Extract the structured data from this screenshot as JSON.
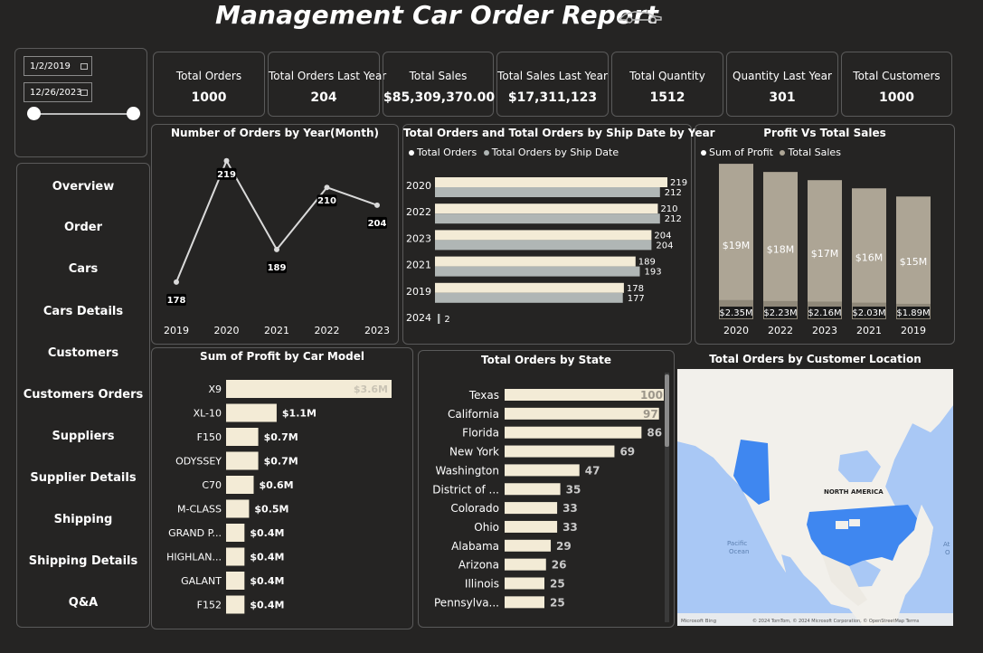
{
  "title": "Management Car Order Report",
  "date_filter": {
    "start": "1/2/2019",
    "end": "12/26/2023"
  },
  "kpis": [
    {
      "label": "Total Orders",
      "value": "1000"
    },
    {
      "label": "Total Orders Last Year",
      "value": "204"
    },
    {
      "label": "Total Sales",
      "value": "$85,309,370.00"
    },
    {
      "label": "Total Sales Last Year",
      "value": "$17,311,123"
    },
    {
      "label": "Total Quantity",
      "value": "1512"
    },
    {
      "label": "Quantity Last Year",
      "value": "301"
    },
    {
      "label": "Total Customers",
      "value": "1000"
    }
  ],
  "nav": [
    "Overview",
    "Order",
    "Cars",
    "Cars Details",
    "Customers",
    "Customers Orders",
    "Suppliers",
    "Supplier Details",
    "Shipping",
    "Shipping Details",
    "Q&A"
  ],
  "colors": {
    "bg": "#252423",
    "cream": "#F3EBD6",
    "gray": "#B0B6B5",
    "taupe": "#ADA595",
    "line": "#DADADA",
    "map_land": "#F2F0EB",
    "map_water": "#A9C8F5",
    "map_highlight": "#3F87F0"
  },
  "chart_data": [
    {
      "type": "line",
      "title": "Number of Orders by Year(Month)",
      "categories": [
        "2019",
        "2020",
        "2021",
        "2022",
        "2023"
      ],
      "values": [
        178,
        219,
        189,
        210,
        204
      ],
      "ylim": [
        170,
        222
      ]
    },
    {
      "type": "bar",
      "orientation": "horizontal",
      "title": "Total Orders and Total Orders by Ship Date by Year",
      "categories": [
        "2020",
        "2022",
        "2023",
        "2021",
        "2019",
        "2024"
      ],
      "series": [
        {
          "name": "Total Orders",
          "values": [
            219,
            210,
            204,
            189,
            178,
            null
          ]
        },
        {
          "name": "Total Orders by Ship Date",
          "values": [
            212,
            212,
            204,
            193,
            177,
            2
          ]
        }
      ],
      "xlim": [
        0,
        219
      ]
    },
    {
      "type": "bar",
      "title": "Profit Vs Total Sales",
      "categories": [
        "2020",
        "2022",
        "2023",
        "2021",
        "2019"
      ],
      "series": [
        {
          "name": "Sum of Profit",
          "values": [
            2.35,
            2.23,
            2.16,
            2.03,
            1.89
          ],
          "labels": [
            "$2.35M",
            "$2.23M",
            "$2.16M",
            "$2.03M",
            "$1.89M"
          ]
        },
        {
          "name": "Total Sales",
          "values": [
            19,
            18,
            17,
            16,
            15
          ],
          "labels": [
            "$19M",
            "$18M",
            "$17M",
            "$16M",
            "$15M"
          ]
        }
      ],
      "ylim": [
        0,
        21
      ]
    },
    {
      "type": "bar",
      "orientation": "horizontal",
      "title": "Sum of Profit by Car Model",
      "categories": [
        "X9",
        "XL-10",
        "F150",
        "ODYSSEY",
        "C70",
        "M-CLASS",
        "GRAND P...",
        "HIGHLAN...",
        "GALANT",
        "F152"
      ],
      "values": [
        3.6,
        1.1,
        0.7,
        0.7,
        0.6,
        0.5,
        0.4,
        0.4,
        0.4,
        0.4
      ],
      "labels": [
        "$3.6M",
        "$1.1M",
        "$0.7M",
        "$0.7M",
        "$0.6M",
        "$0.5M",
        "$0.4M",
        "$0.4M",
        "$0.4M",
        "$0.4M"
      ],
      "xlim": [
        0,
        3.6
      ]
    },
    {
      "type": "bar",
      "orientation": "horizontal",
      "title": "Total Orders by State",
      "categories": [
        "Texas",
        "California",
        "Florida",
        "New York",
        "Washington",
        "District of ...",
        "Colorado",
        "Ohio",
        "Alabama",
        "Arizona",
        "Illinois",
        "Pennsylva..."
      ],
      "values": [
        100,
        97,
        86,
        69,
        47,
        35,
        33,
        33,
        29,
        26,
        25,
        25
      ],
      "xlim": [
        0,
        100
      ]
    }
  ],
  "map": {
    "title": "Total Orders by Customer Location",
    "region_label": "NORTH AMERICA",
    "ocean_label_left": "Pacific\nOcean",
    "ocean_label_right": "At\nO",
    "attribution": "© 2024 TomTom, © 2024 Microsoft Corporation, © OpenStreetMap  Terms",
    "bing_logo": "Microsoft Bing"
  }
}
